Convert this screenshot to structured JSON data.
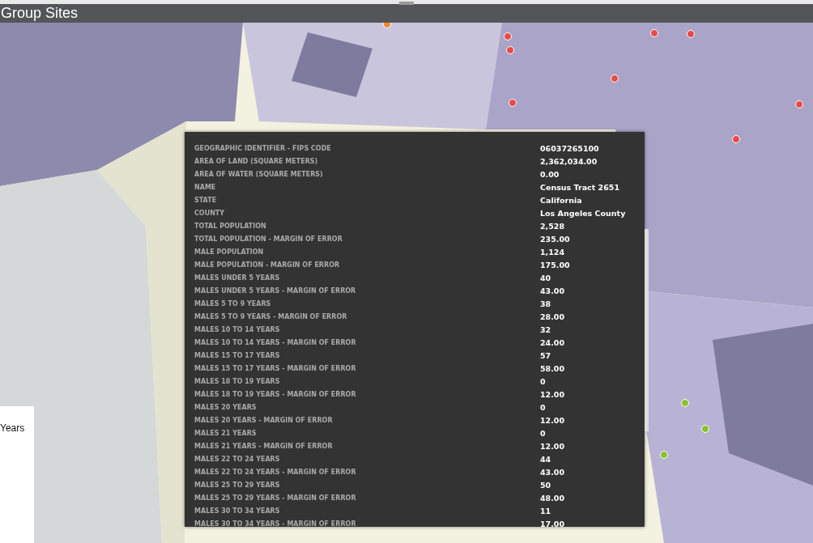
{
  "title": "Group Sites",
  "legend": {
    "label": "Years"
  },
  "popup": {
    "rows": [
      {
        "label": "GEOGRAPHIC IDENTIFIER - FIPS CODE",
        "value": "06037265100"
      },
      {
        "label": "AREA OF LAND (SQUARE METERS)",
        "value": "2,362,034.00"
      },
      {
        "label": "AREA OF WATER (SQUARE METERS)",
        "value": "0.00"
      },
      {
        "label": "NAME",
        "value": "Census Tract 2651"
      },
      {
        "label": "STATE",
        "value": "California"
      },
      {
        "label": "COUNTY",
        "value": "Los Angeles County"
      },
      {
        "label": "TOTAL POPULATION",
        "value": "2,528"
      },
      {
        "label": "TOTAL POPULATION - MARGIN OF ERROR",
        "value": "235.00"
      },
      {
        "label": "MALE POPULATION",
        "value": "1,124"
      },
      {
        "label": "MALE POPULATION - MARGIN OF ERROR",
        "value": "175.00"
      },
      {
        "label": "MALES UNDER 5 YEARS",
        "value": "40"
      },
      {
        "label": "MALES UNDER 5 YEARS - MARGIN OF ERROR",
        "value": "43.00"
      },
      {
        "label": "MALES 5 TO 9 YEARS",
        "value": "38"
      },
      {
        "label": "MALES 5 TO 9 YEARS - MARGIN OF ERROR",
        "value": "28.00"
      },
      {
        "label": "MALES 10 TO 14 YEARS",
        "value": "32"
      },
      {
        "label": "MALES 10 TO 14 YEARS - MARGIN OF ERROR",
        "value": "24.00"
      },
      {
        "label": "MALES 15 TO 17 YEARS",
        "value": "57"
      },
      {
        "label": "MALES 15 TO 17 YEARS - MARGIN OF ERROR",
        "value": "58.00"
      },
      {
        "label": "MALES 18 TO 19 YEARS",
        "value": "0"
      },
      {
        "label": "MALES 18 TO 19 YEARS - MARGIN OF ERROR",
        "value": "12.00"
      },
      {
        "label": "MALES 20 YEARS",
        "value": "0"
      },
      {
        "label": "MALES 20 YEARS - MARGIN OF ERROR",
        "value": "12.00"
      },
      {
        "label": "MALES 21 YEARS",
        "value": "0"
      },
      {
        "label": "MALES 21 YEARS - MARGIN OF ERROR",
        "value": "12.00"
      },
      {
        "label": "MALES 22 TO 24 YEARS",
        "value": "44"
      },
      {
        "label": "MALES 22 TO 24 YEARS - MARGIN OF ERROR",
        "value": "43.00"
      },
      {
        "label": "MALES 25 TO 29 YEARS",
        "value": "50"
      },
      {
        "label": "MALES 25 TO 29 YEARS - MARGIN OF ERROR",
        "value": "48.00"
      },
      {
        "label": "MALES 30 TO 34 YEARS",
        "value": "11"
      },
      {
        "label": "MALES 30 TO 34 YEARS - MARGIN OF ERROR",
        "value": "17.00"
      }
    ]
  }
}
